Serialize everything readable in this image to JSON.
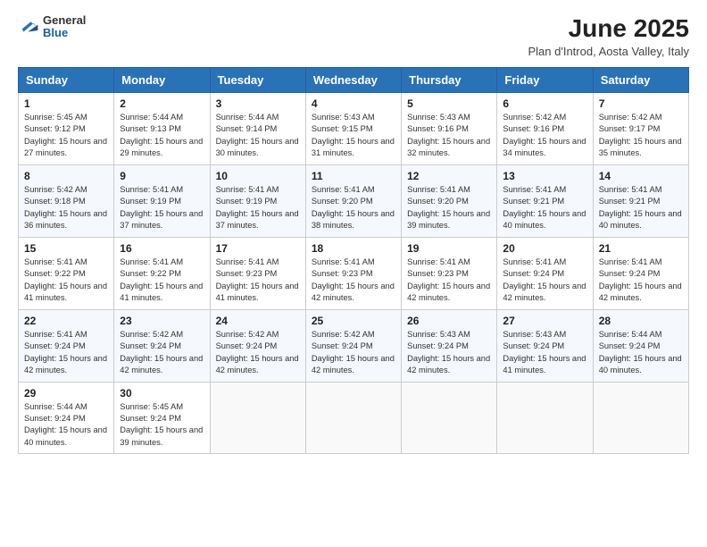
{
  "header": {
    "logo": {
      "general": "General",
      "blue": "Blue"
    },
    "title": "June 2025",
    "subtitle": "Plan d'Introd, Aosta Valley, Italy"
  },
  "calendar": {
    "headers": [
      "Sunday",
      "Monday",
      "Tuesday",
      "Wednesday",
      "Thursday",
      "Friday",
      "Saturday"
    ],
    "weeks": [
      [
        null,
        {
          "num": "2",
          "sunrise": "5:44 AM",
          "sunset": "9:13 PM",
          "daylight": "15 hours and 29 minutes."
        },
        {
          "num": "3",
          "sunrise": "5:44 AM",
          "sunset": "9:14 PM",
          "daylight": "15 hours and 30 minutes."
        },
        {
          "num": "4",
          "sunrise": "5:43 AM",
          "sunset": "9:15 PM",
          "daylight": "15 hours and 31 minutes."
        },
        {
          "num": "5",
          "sunrise": "5:43 AM",
          "sunset": "9:16 PM",
          "daylight": "15 hours and 32 minutes."
        },
        {
          "num": "6",
          "sunrise": "5:42 AM",
          "sunset": "9:16 PM",
          "daylight": "15 hours and 34 minutes."
        },
        {
          "num": "7",
          "sunrise": "5:42 AM",
          "sunset": "9:17 PM",
          "daylight": "15 hours and 35 minutes."
        }
      ],
      [
        {
          "num": "8",
          "sunrise": "5:42 AM",
          "sunset": "9:18 PM",
          "daylight": "15 hours and 36 minutes."
        },
        {
          "num": "9",
          "sunrise": "5:41 AM",
          "sunset": "9:19 PM",
          "daylight": "15 hours and 37 minutes."
        },
        {
          "num": "10",
          "sunrise": "5:41 AM",
          "sunset": "9:19 PM",
          "daylight": "15 hours and 37 minutes."
        },
        {
          "num": "11",
          "sunrise": "5:41 AM",
          "sunset": "9:20 PM",
          "daylight": "15 hours and 38 minutes."
        },
        {
          "num": "12",
          "sunrise": "5:41 AM",
          "sunset": "9:20 PM",
          "daylight": "15 hours and 39 minutes."
        },
        {
          "num": "13",
          "sunrise": "5:41 AM",
          "sunset": "9:21 PM",
          "daylight": "15 hours and 40 minutes."
        },
        {
          "num": "14",
          "sunrise": "5:41 AM",
          "sunset": "9:21 PM",
          "daylight": "15 hours and 40 minutes."
        }
      ],
      [
        {
          "num": "15",
          "sunrise": "5:41 AM",
          "sunset": "9:22 PM",
          "daylight": "15 hours and 41 minutes."
        },
        {
          "num": "16",
          "sunrise": "5:41 AM",
          "sunset": "9:22 PM",
          "daylight": "15 hours and 41 minutes."
        },
        {
          "num": "17",
          "sunrise": "5:41 AM",
          "sunset": "9:23 PM",
          "daylight": "15 hours and 41 minutes."
        },
        {
          "num": "18",
          "sunrise": "5:41 AM",
          "sunset": "9:23 PM",
          "daylight": "15 hours and 42 minutes."
        },
        {
          "num": "19",
          "sunrise": "5:41 AM",
          "sunset": "9:23 PM",
          "daylight": "15 hours and 42 minutes."
        },
        {
          "num": "20",
          "sunrise": "5:41 AM",
          "sunset": "9:24 PM",
          "daylight": "15 hours and 42 minutes."
        },
        {
          "num": "21",
          "sunrise": "5:41 AM",
          "sunset": "9:24 PM",
          "daylight": "15 hours and 42 minutes."
        }
      ],
      [
        {
          "num": "22",
          "sunrise": "5:41 AM",
          "sunset": "9:24 PM",
          "daylight": "15 hours and 42 minutes."
        },
        {
          "num": "23",
          "sunrise": "5:42 AM",
          "sunset": "9:24 PM",
          "daylight": "15 hours and 42 minutes."
        },
        {
          "num": "24",
          "sunrise": "5:42 AM",
          "sunset": "9:24 PM",
          "daylight": "15 hours and 42 minutes."
        },
        {
          "num": "25",
          "sunrise": "5:42 AM",
          "sunset": "9:24 PM",
          "daylight": "15 hours and 42 minutes."
        },
        {
          "num": "26",
          "sunrise": "5:43 AM",
          "sunset": "9:24 PM",
          "daylight": "15 hours and 42 minutes."
        },
        {
          "num": "27",
          "sunrise": "5:43 AM",
          "sunset": "9:24 PM",
          "daylight": "15 hours and 41 minutes."
        },
        {
          "num": "28",
          "sunrise": "5:44 AM",
          "sunset": "9:24 PM",
          "daylight": "15 hours and 40 minutes."
        }
      ],
      [
        {
          "num": "29",
          "sunrise": "5:44 AM",
          "sunset": "9:24 PM",
          "daylight": "15 hours and 40 minutes."
        },
        {
          "num": "30",
          "sunrise": "5:45 AM",
          "sunset": "9:24 PM",
          "daylight": "15 hours and 39 minutes."
        },
        null,
        null,
        null,
        null,
        null
      ]
    ],
    "first_week_day1": {
      "num": "1",
      "sunrise": "5:45 AM",
      "sunset": "9:12 PM",
      "daylight": "15 hours and 27 minutes."
    }
  }
}
